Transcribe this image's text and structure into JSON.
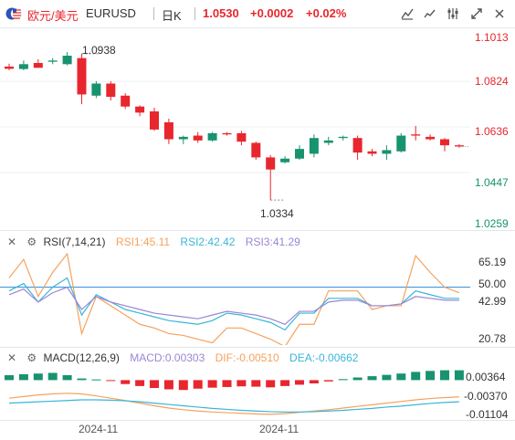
{
  "header": {
    "symbol_cn": "欧元/美元",
    "symbol": "EURUSD",
    "timeframe": "日K",
    "price": "1.0530",
    "change": "+0.0002",
    "change_pct": "+0.02%",
    "tools": [
      "draw-icon",
      "indicator-icon",
      "settings-icon",
      "expand-icon",
      "close-icon"
    ]
  },
  "colors": {
    "up": "#e8262d",
    "down": "#17936f",
    "rsi1": "#f5a25d",
    "rsi2": "#38b6d9",
    "rsi3": "#9b86d6",
    "ref": "#2a8ad8"
  },
  "price_axis": [
    "1.1013",
    "1.0824",
    "1.0636",
    "1.0447",
    "1.0259"
  ],
  "annotations": {
    "high": "1.0938",
    "low": "1.0334"
  },
  "chart_data": [
    {
      "type": "candlestick",
      "ylim": [
        1.0259,
        1.1013
      ],
      "candles": [
        {
          "o": 1.0885,
          "h": 1.0897,
          "l": 1.087,
          "c": 1.0876
        },
        {
          "o": 1.0875,
          "h": 1.091,
          "l": 1.087,
          "c": 1.0895
        },
        {
          "o": 1.09,
          "h": 1.0915,
          "l": 1.089,
          "c": 1.088
        },
        {
          "o": 1.0905,
          "h": 1.092,
          "l": 1.0895,
          "c": 1.091
        },
        {
          "o": 1.0895,
          "h": 1.0945,
          "l": 1.089,
          "c": 1.093
        },
        {
          "o": 1.092,
          "h": 1.0938,
          "l": 1.073,
          "c": 1.077
        },
        {
          "o": 1.0765,
          "h": 1.0825,
          "l": 1.0755,
          "c": 1.0815
        },
        {
          "o": 1.0815,
          "h": 1.0825,
          "l": 1.0745,
          "c": 1.076
        },
        {
          "o": 1.0765,
          "h": 1.0775,
          "l": 1.071,
          "c": 1.072
        },
        {
          "o": 1.072,
          "h": 1.0725,
          "l": 1.068,
          "c": 1.0695
        },
        {
          "o": 1.07,
          "h": 1.0715,
          "l": 1.062,
          "c": 1.0625
        },
        {
          "o": 1.0655,
          "h": 1.067,
          "l": 1.0565,
          "c": 1.0585
        },
        {
          "o": 1.0585,
          "h": 1.06,
          "l": 1.0565,
          "c": 1.0595
        },
        {
          "o": 1.06,
          "h": 1.0615,
          "l": 1.057,
          "c": 1.058
        },
        {
          "o": 1.058,
          "h": 1.0615,
          "l": 1.0575,
          "c": 1.061
        },
        {
          "o": 1.061,
          "h": 1.0615,
          "l": 1.06,
          "c": 1.0605
        },
        {
          "o": 1.061,
          "h": 1.062,
          "l": 1.056,
          "c": 1.0575
        },
        {
          "o": 1.057,
          "h": 1.0575,
          "l": 1.05,
          "c": 1.051
        },
        {
          "o": 1.051,
          "h": 1.052,
          "l": 1.0334,
          "c": 1.046
        },
        {
          "o": 1.049,
          "h": 1.0515,
          "l": 1.0485,
          "c": 1.0505
        },
        {
          "o": 1.0505,
          "h": 1.056,
          "l": 1.05,
          "c": 1.0545
        },
        {
          "o": 1.0525,
          "h": 1.0605,
          "l": 1.051,
          "c": 1.059
        },
        {
          "o": 1.057,
          "h": 1.0595,
          "l": 1.056,
          "c": 1.058
        },
        {
          "o": 1.059,
          "h": 1.06,
          "l": 1.058,
          "c": 1.0595
        },
        {
          "o": 1.059,
          "h": 1.06,
          "l": 1.05,
          "c": 1.053
        },
        {
          "o": 1.0535,
          "h": 1.0545,
          "l": 1.0515,
          "c": 1.0525
        },
        {
          "o": 1.0525,
          "h": 1.056,
          "l": 1.05,
          "c": 1.054
        },
        {
          "o": 1.0535,
          "h": 1.061,
          "l": 1.053,
          "c": 1.06
        },
        {
          "o": 1.0605,
          "h": 1.064,
          "l": 1.058,
          "c": 1.06
        },
        {
          "o": 1.0595,
          "h": 1.0605,
          "l": 1.058,
          "c": 1.0585
        },
        {
          "o": 1.0585,
          "h": 1.059,
          "l": 1.0535,
          "c": 1.056
        },
        {
          "o": 1.056,
          "h": 1.0565,
          "l": 1.055,
          "c": 1.0555
        }
      ]
    },
    {
      "type": "line",
      "title": "RSI(7,14,21)",
      "ylim": [
        20.78,
        70
      ],
      "reference": 50.0,
      "axis_labels": [
        "65.19",
        "50.00",
        "42.99",
        "20.78"
      ],
      "series": [
        {
          "name": "RSI1",
          "value": "45.11",
          "values": [
            55,
            65,
            45,
            58,
            68,
            25,
            45,
            40,
            35,
            30,
            28,
            25,
            24,
            22,
            20,
            28,
            28,
            25,
            22,
            18,
            30,
            30,
            48,
            48,
            48,
            38,
            40,
            40,
            67,
            58,
            50,
            47
          ]
        },
        {
          "name": "RSI2",
          "value": "42.42",
          "values": [
            48,
            52,
            42,
            50,
            55,
            35,
            46,
            42,
            38,
            36,
            34,
            32,
            31,
            30,
            32,
            36,
            35,
            33,
            31,
            27,
            36,
            36,
            44,
            44,
            44,
            40,
            40,
            41,
            48,
            46,
            44,
            44
          ]
        },
        {
          "name": "RSI3",
          "value": "41.29",
          "values": [
            46,
            49,
            42,
            47,
            50,
            38,
            45,
            42,
            40,
            38,
            36,
            35,
            34,
            33,
            35,
            37,
            36,
            35,
            33,
            30,
            37,
            37,
            42,
            43,
            43,
            40,
            40,
            41,
            45,
            44,
            43,
            43
          ]
        }
      ]
    },
    {
      "type": "bar",
      "title": "MACD(12,26,9)",
      "ylim": [
        -0.01104,
        0.00364
      ],
      "axis_labels": [
        "0.00364",
        "-0.00370",
        "-0.01104"
      ],
      "legend": [
        {
          "name": "MACD",
          "value": "0.00303"
        },
        {
          "name": "DIF",
          "value": "-0.00510"
        },
        {
          "name": "DEA",
          "value": "-0.00662"
        }
      ],
      "values": [
        0.0015,
        0.0018,
        0.002,
        0.0022,
        0.0015,
        0.0005,
        0.0002,
        -0.0002,
        -0.0012,
        -0.0018,
        -0.0024,
        -0.0028,
        -0.003,
        -0.0026,
        -0.0023,
        -0.0021,
        -0.0019,
        -0.002,
        -0.0022,
        -0.0018,
        -0.0014,
        -0.001,
        -0.0004,
        0.0003,
        0.0008,
        0.0012,
        0.0016,
        0.002,
        0.0025,
        0.0028,
        0.003,
        0.003
      ],
      "dif": [
        -0.0055,
        -0.005,
        -0.0045,
        -0.0042,
        -0.004,
        -0.0042,
        -0.0048,
        -0.0055,
        -0.0062,
        -0.007,
        -0.0078,
        -0.0085,
        -0.009,
        -0.0094,
        -0.0097,
        -0.0099,
        -0.0101,
        -0.0103,
        -0.0104,
        -0.0102,
        -0.0098,
        -0.0094,
        -0.009,
        -0.0085,
        -0.008,
        -0.0075,
        -0.007,
        -0.0065,
        -0.006,
        -0.0056,
        -0.0053,
        -0.0051
      ],
      "dea": [
        -0.007,
        -0.0068,
        -0.0066,
        -0.0064,
        -0.0062,
        -0.006,
        -0.006,
        -0.0061,
        -0.0063,
        -0.0066,
        -0.007,
        -0.0074,
        -0.0078,
        -0.0082,
        -0.0086,
        -0.0089,
        -0.0092,
        -0.0094,
        -0.0096,
        -0.0097,
        -0.0097,
        -0.0096,
        -0.0094,
        -0.0092,
        -0.0089,
        -0.0086,
        -0.0082,
        -0.0079,
        -0.0075,
        -0.0071,
        -0.0068,
        -0.0066
      ]
    }
  ],
  "x_axis": [
    "2024-11",
    "2024-11"
  ]
}
